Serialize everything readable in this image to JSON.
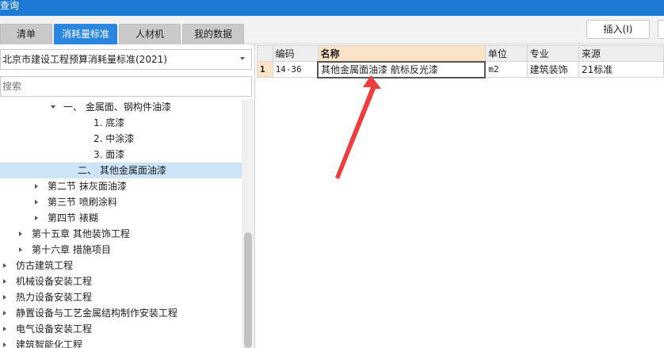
{
  "window": {
    "title": "查询"
  },
  "tabs": [
    {
      "label": "清单",
      "active": false
    },
    {
      "label": "消耗量标准",
      "active": true
    },
    {
      "label": "人材机",
      "active": false
    },
    {
      "label": "我的数据",
      "active": false
    }
  ],
  "toolbar": {
    "insert_label": "插入(I)"
  },
  "left": {
    "standard_select": "北京市建设工程预算消耗量标准(2021)",
    "search_placeholder": "搜索",
    "tree": [
      {
        "label": "一、 金属面、钢构件油漆",
        "level": 3,
        "arrow": "down",
        "selected": false
      },
      {
        "label": "1. 底漆",
        "level": 5,
        "arrow": "none",
        "selected": false
      },
      {
        "label": "2. 中涂漆",
        "level": 5,
        "arrow": "none",
        "selected": false
      },
      {
        "label": "3. 面漆",
        "level": 5,
        "arrow": "none",
        "selected": false
      },
      {
        "label": "二、 其他金属面油漆",
        "level": 4,
        "arrow": "none",
        "selected": true
      },
      {
        "label": "第二节 抹灰面油漆",
        "level": 2,
        "arrow": "right",
        "selected": false
      },
      {
        "label": "第三节 喷刷涂料",
        "level": 2,
        "arrow": "right",
        "selected": false
      },
      {
        "label": "第四节 裱糊",
        "level": 2,
        "arrow": "right",
        "selected": false
      },
      {
        "label": "第十五章 其他装饰工程",
        "level": 1,
        "arrow": "right",
        "selected": false
      },
      {
        "label": "第十六章 措施项目",
        "level": 1,
        "arrow": "right",
        "selected": false
      },
      {
        "label": "仿古建筑工程",
        "level": 0,
        "arrow": "right",
        "selected": false
      },
      {
        "label": "机械设备安装工程",
        "level": 0,
        "arrow": "right",
        "selected": false
      },
      {
        "label": "热力设备安装工程",
        "level": 0,
        "arrow": "right",
        "selected": false
      },
      {
        "label": "静置设备与工艺金属结构制作安装工程",
        "level": 0,
        "arrow": "right",
        "selected": false
      },
      {
        "label": "电气设备安装工程",
        "level": 0,
        "arrow": "right",
        "selected": false
      },
      {
        "label": "建筑智能化工程",
        "level": 0,
        "arrow": "right",
        "selected": false
      }
    ]
  },
  "grid": {
    "columns": [
      "编码",
      "名称",
      "单位",
      "专业",
      "来源"
    ],
    "rows": [
      {
        "index": "1",
        "code": "14-36",
        "name": "其他金属面油漆 航标反光漆",
        "unit": "m2",
        "major": "建筑装饰",
        "source": "21标准"
      }
    ]
  },
  "colors": {
    "title_bar": "#1c7ad6",
    "active_tab": "#2b86e0",
    "selected_row": "#cce4f7",
    "header_highlight": "#fbe3c8",
    "annotation_arrow": "#f03c3c"
  }
}
